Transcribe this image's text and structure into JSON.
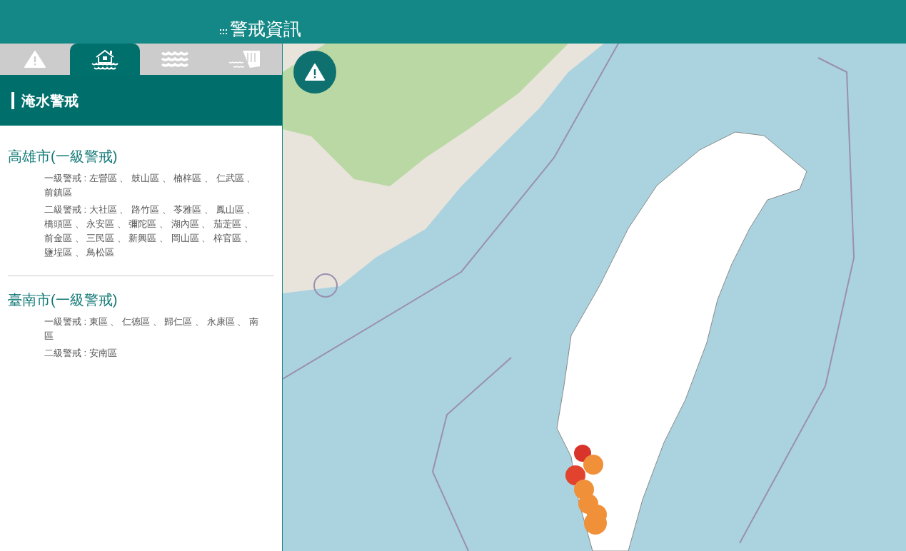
{
  "header": {
    "title": "警戒資訊"
  },
  "tabs": [
    {
      "kind": "warning",
      "selected": false
    },
    {
      "kind": "flood",
      "selected": true
    },
    {
      "kind": "waves",
      "selected": false
    },
    {
      "kind": "dam",
      "selected": false
    }
  ],
  "panel": {
    "title": "淹水警戒"
  },
  "regions": [
    {
      "name": "高雄市(一級警戒)",
      "levels": [
        {
          "lines": [
            "一級警戒 : 左營區 、 鼓山區 、 楠梓區 、 仁武區 、",
            "前鎮區"
          ]
        },
        {
          "lines": [
            "二級警戒 : 大社區 、 路竹區 、 苓雅區 、 鳳山區 、",
            "橋頭區 、 永安區 、 彌陀區 、 湖內區 、 茄萣區 、",
            "前金區 、 三民區 、 新興區 、 岡山區 、 梓官區 、",
            "鹽埕區 、 鳥松區"
          ]
        }
      ]
    },
    {
      "name": "臺南市(一級警戒)",
      "levels": [
        {
          "lines": [
            "一級警戒 : 東區 、 仁德區 、 歸仁區 、 永康區 、 南",
            "區"
          ]
        },
        {
          "lines": [
            "二級警戒 : 安南區"
          ]
        }
      ]
    }
  ]
}
